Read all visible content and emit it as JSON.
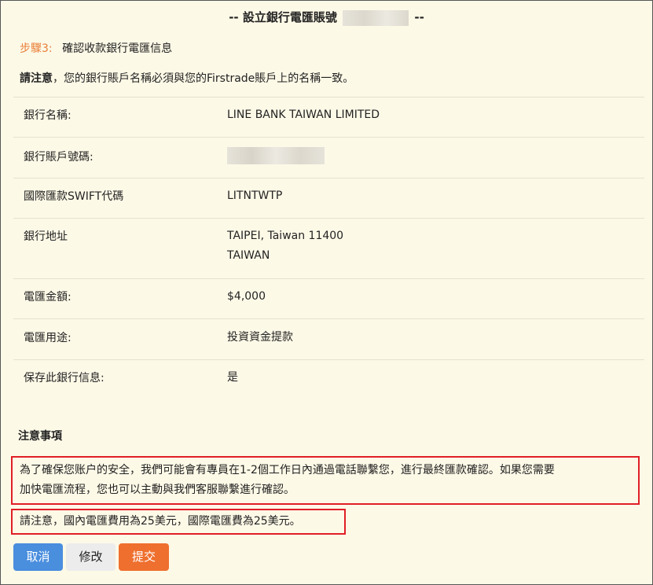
{
  "header": {
    "title_prefix": "-- 設立銀行電匯賬號",
    "title_suffix": "--"
  },
  "step": {
    "number": "步驟3:",
    "text": "確認收款銀行電匯信息"
  },
  "notice": {
    "bold": "請注意",
    "text": "，您的銀行賬戶名稱必須與您的Firstrade賬戶上的名稱一致。"
  },
  "details": [
    {
      "label": "銀行名稱:",
      "value": "LINE BANK TAIWAN LIMITED"
    },
    {
      "label": "銀行賬戶號碼:",
      "value": ""
    },
    {
      "label": "國際匯款SWIFT代碼",
      "value": "LITNTWTP"
    },
    {
      "label": "銀行地址",
      "value": "TAIPEI, Taiwan 11400",
      "value2": "TAIWAN"
    },
    {
      "label": "電匯金額:",
      "value": "$4,000"
    },
    {
      "label": "電匯用途:",
      "value": "投資資金提款"
    },
    {
      "label": "保存此銀行信息:",
      "value": "是"
    }
  ],
  "notes": {
    "heading": "注意事項",
    "line1a": "為了確保您账户的安全，我們可能會有專員在1-2個工作日內通過電話聯繫您，進行最終匯款確認。如果您需要",
    "line1b": "加快電匯流程，您也可以主動與我們客服聯繫進行確認。",
    "line2": "請注意，國內電匯費用為25美元，國際電匯費為25美元。"
  },
  "buttons": {
    "cancel": "取消",
    "edit": "修改",
    "submit": "提交"
  },
  "colors": {
    "background": "#fdf9e7",
    "step_accent": "#e9803a",
    "highlight_border": "#e01f26",
    "cancel_button": "#4a8ede",
    "submit_button": "#ef6f2e"
  }
}
